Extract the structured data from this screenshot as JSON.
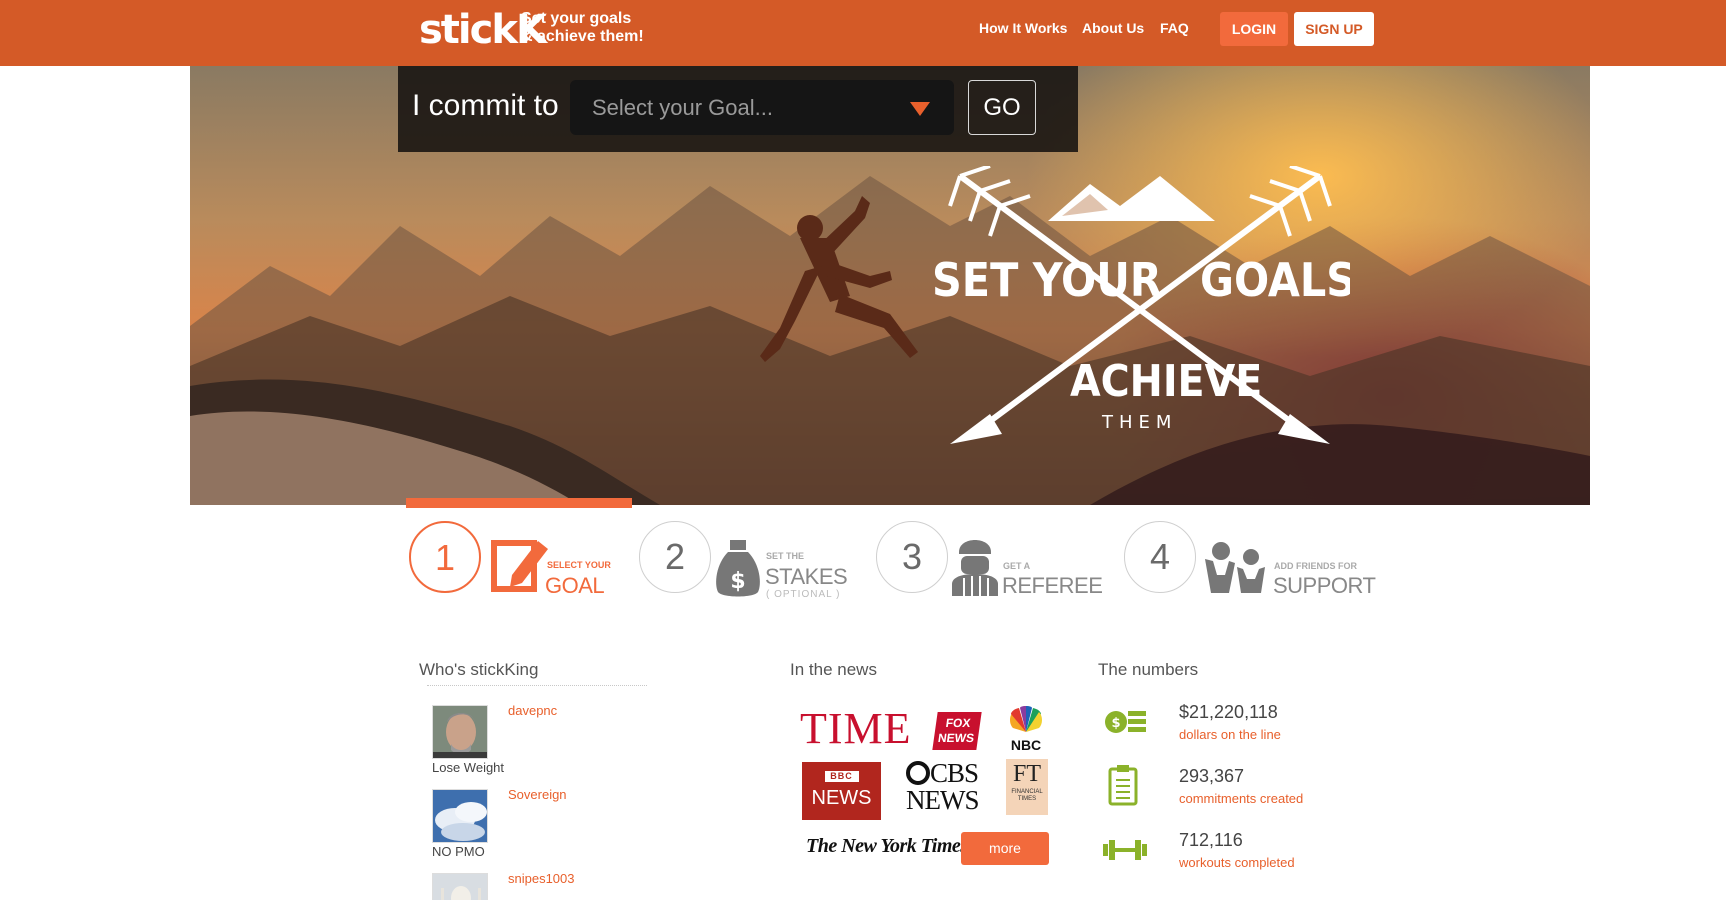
{
  "header": {
    "logo": "stickK",
    "tagline_line1": "Set your goals",
    "tagline_line2": "& achieve them!",
    "nav": [
      "How It Works",
      "About Us",
      "FAQ"
    ],
    "login_label": "LOGIN",
    "signup_label": "SIGN UP"
  },
  "hero": {
    "commit_label": "I commit to",
    "goal_select_placeholder": "Select your Goal...",
    "go_label": "GO",
    "emblem_line1_left": "SET YOUR",
    "emblem_line1_right": "GOALS &",
    "emblem_line2": "ACHIEVE",
    "emblem_line3": "THEM"
  },
  "steps": [
    {
      "number": "1",
      "small": "SELECT YOUR",
      "big": "GOAL",
      "note": ""
    },
    {
      "number": "2",
      "small": "SET THE",
      "big": "STAKES",
      "note": "( OPTIONAL )"
    },
    {
      "number": "3",
      "small": "GET A",
      "big": "REFEREE",
      "note": ""
    },
    {
      "number": "4",
      "small": "ADD FRIENDS FOR",
      "big": "SUPPORT",
      "note": ""
    }
  ],
  "whos_sticking": {
    "heading": "Who's stickKing",
    "entries": [
      {
        "user": "davepnc",
        "goal": "Lose Weight"
      },
      {
        "user": "Sovereign",
        "goal": "NO PMO"
      },
      {
        "user": "snipes1003",
        "goal": ""
      }
    ]
  },
  "news": {
    "heading": "In the news",
    "logos": [
      "TIME",
      "FOX NEWS",
      "NBC",
      "BBC NEWS",
      "CBS NEWS",
      "FT",
      "The New York Times"
    ],
    "more_label": "more"
  },
  "numbers": {
    "heading": "The numbers",
    "stats": [
      {
        "value": "$21,220,118",
        "label": "dollars on the line",
        "icon": "money-stack-icon"
      },
      {
        "value": "293,367",
        "label": "commitments created",
        "icon": "clipboard-icon"
      },
      {
        "value": "712,116",
        "label": "workouts completed",
        "icon": "dumbbell-icon"
      }
    ]
  },
  "colors": {
    "brand": "#d45a27",
    "accent": "#f26a3c",
    "stat_green": "#8bb22a"
  }
}
